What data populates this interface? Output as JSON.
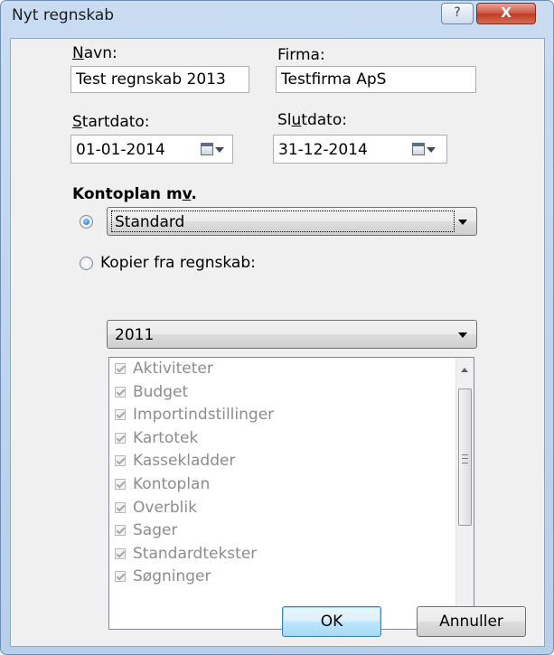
{
  "window": {
    "title": "Nyt regnskab",
    "help_symbol": "?",
    "close_symbol": "X"
  },
  "form": {
    "navn_label": "Navn:",
    "navn_value": "Test regnskab 2013",
    "firma_label": "Firma:",
    "firma_value": "Testfirma ApS",
    "startdato_label": "Startdato:",
    "startdato_value": "01-01-2014",
    "slutdato_label": "Slutdato:",
    "slutdato_value": "31-12-2014"
  },
  "kontoplan": {
    "section_title": "Kontoplan mv.",
    "standard_selected": true,
    "standard_value": "Standard",
    "kopier_label": "Kopier fra regnskab:",
    "kopier_selected": false,
    "kopier_value": "2011",
    "items": [
      {
        "label": "Aktiviteter",
        "checked": true
      },
      {
        "label": "Budget",
        "checked": true
      },
      {
        "label": "Importindstillinger",
        "checked": true
      },
      {
        "label": "Kartotek",
        "checked": true
      },
      {
        "label": "Kassekladder",
        "checked": true
      },
      {
        "label": "Kontoplan",
        "checked": true
      },
      {
        "label": "Overblik",
        "checked": true
      },
      {
        "label": "Sager",
        "checked": true
      },
      {
        "label": "Standardtekster",
        "checked": true
      },
      {
        "label": "Søgninger",
        "checked": true
      }
    ]
  },
  "buttons": {
    "ok": "OK",
    "annuller": "Annuller"
  },
  "icons": {
    "help": "help-icon",
    "close": "close-icon",
    "calendar": "calendar-icon"
  }
}
